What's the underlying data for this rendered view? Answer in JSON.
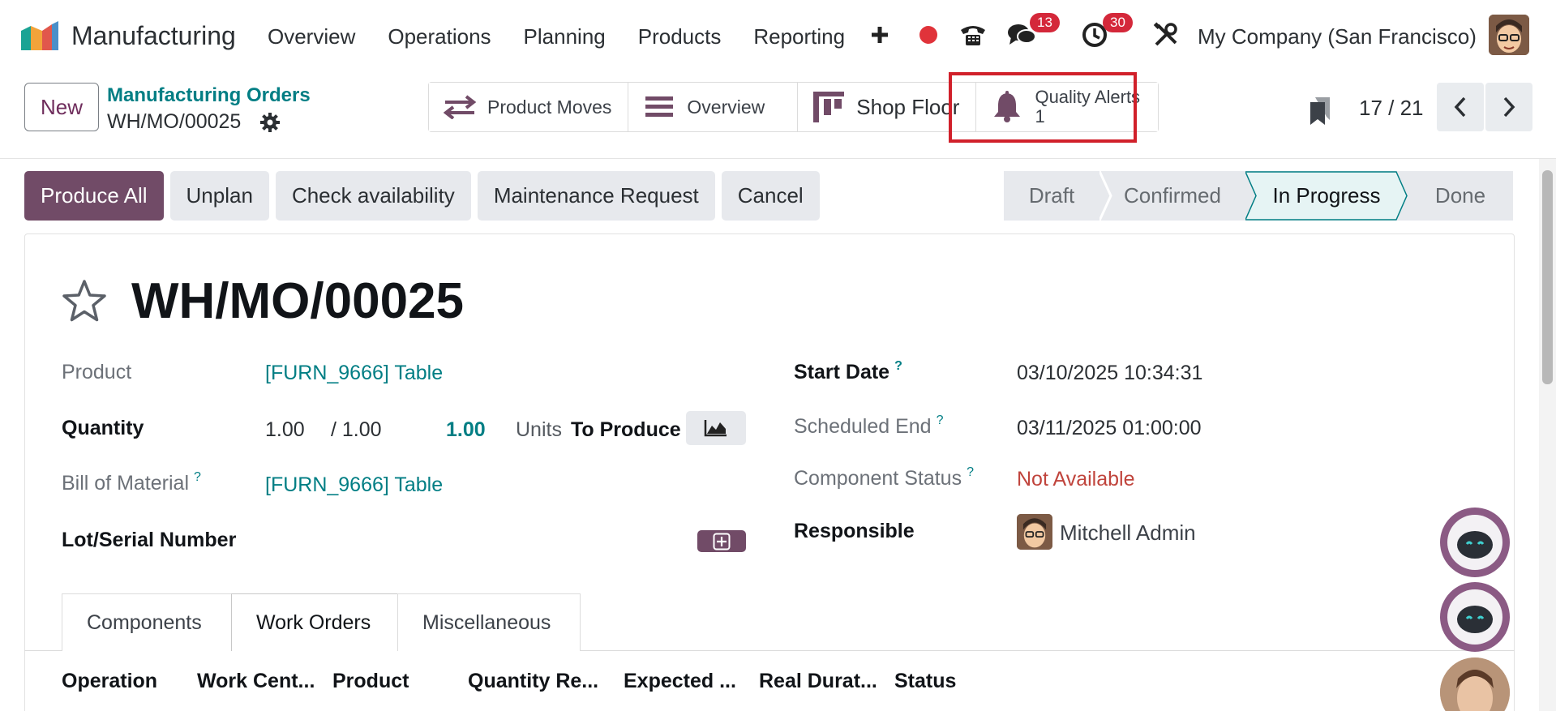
{
  "nav": {
    "app_name": "Manufacturing",
    "menu": [
      "Overview",
      "Operations",
      "Planning",
      "Products",
      "Reporting"
    ],
    "messages_count": "13",
    "activities_count": "30",
    "company": "My Company (San Francisco)"
  },
  "control": {
    "new_label": "New",
    "breadcrumb": "Manufacturing Orders",
    "record": "WH/MO/00025",
    "smart_buttons": {
      "product_moves": "Product Moves",
      "overview": "Overview",
      "shop_floor": "Shop Floor",
      "quality_alerts": "Quality Alerts",
      "quality_alerts_count": "1"
    },
    "pager": "17 / 21"
  },
  "actions": {
    "produce_all": "Produce All",
    "unplan": "Unplan",
    "check_availability": "Check availability",
    "maintenance_request": "Maintenance Request",
    "cancel": "Cancel"
  },
  "status": {
    "stages": [
      "Draft",
      "Confirmed",
      "In Progress",
      "Done"
    ],
    "current": "In Progress"
  },
  "form": {
    "title": "WH/MO/00025",
    "product_label": "Product",
    "product_value": "[FURN_9666] Table",
    "quantity_label": "Quantity",
    "quantity_produced": "1.00",
    "quantity_total": "/ 1.00",
    "quantity_to_produce": "1.00",
    "uom": "Units",
    "to_produce": "To Produce",
    "bom_label": "Bill of Material",
    "bom_value": "[FURN_9666] Table",
    "lot_label": "Lot/Serial Number",
    "start_label": "Start Date",
    "start_value": "03/10/2025 10:34:31",
    "end_label": "Scheduled End",
    "end_value": "03/11/2025 01:00:00",
    "component_label": "Component Status",
    "component_value": "Not Available",
    "responsible_label": "Responsible",
    "responsible_value": "Mitchell Admin",
    "help": "?"
  },
  "tabs": [
    "Components",
    "Work Orders",
    "Miscellaneous"
  ],
  "table_headers": [
    "Operation",
    "Work Cent...",
    "Product",
    "Quantity Re...",
    "Expected ...",
    "Real Durat...",
    "Status"
  ],
  "colors": {
    "brand": "#714b67",
    "link": "#017e84",
    "highlight": "#d1202a",
    "badge": "#d4283a",
    "danger_text": "#c0443c"
  }
}
